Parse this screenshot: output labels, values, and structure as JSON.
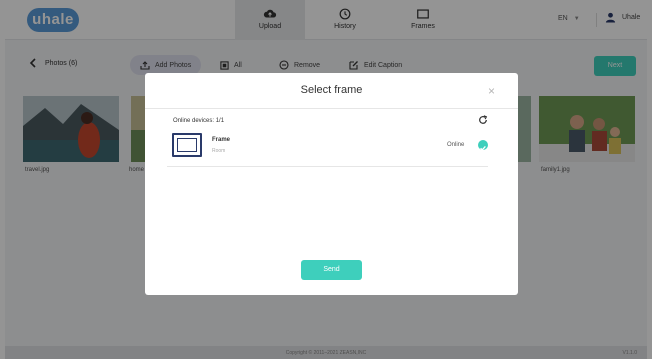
{
  "app": {
    "logo_text": "uhale",
    "nav": [
      {
        "label": "Upload",
        "icon": "cloud-upload-icon",
        "active": true
      },
      {
        "label": "History",
        "icon": "clock-icon",
        "active": false
      },
      {
        "label": "Frames",
        "icon": "frame-icon",
        "active": false
      }
    ],
    "language": "EN",
    "user_name": "Uhale"
  },
  "toolbar": {
    "back_label": "Photos (6)",
    "add_photos_label": "Add Photos",
    "all_label": "All",
    "remove_label": "Remove",
    "edit_caption_label": "Edit Caption",
    "next_label": "Next"
  },
  "photos": [
    {
      "name": "travel.jpg"
    },
    {
      "name": "home"
    },
    {
      "name": "family1.jpg"
    }
  ],
  "footer": {
    "copyright": "Copyright © 2011–2021 ZEASN,INC",
    "version": "V1.1.0"
  },
  "modal": {
    "title": "Select frame",
    "close_symbol": "×",
    "devices_label": "Online devices: 1/1",
    "devices": [
      {
        "name": "Frame",
        "room": "Room",
        "status": "Online",
        "selected": true
      }
    ],
    "send_label": "Send"
  },
  "colors": {
    "accent": "#3ecfbc",
    "logo": "#5a9bd9",
    "frame_icon": "#2a3a6a"
  }
}
